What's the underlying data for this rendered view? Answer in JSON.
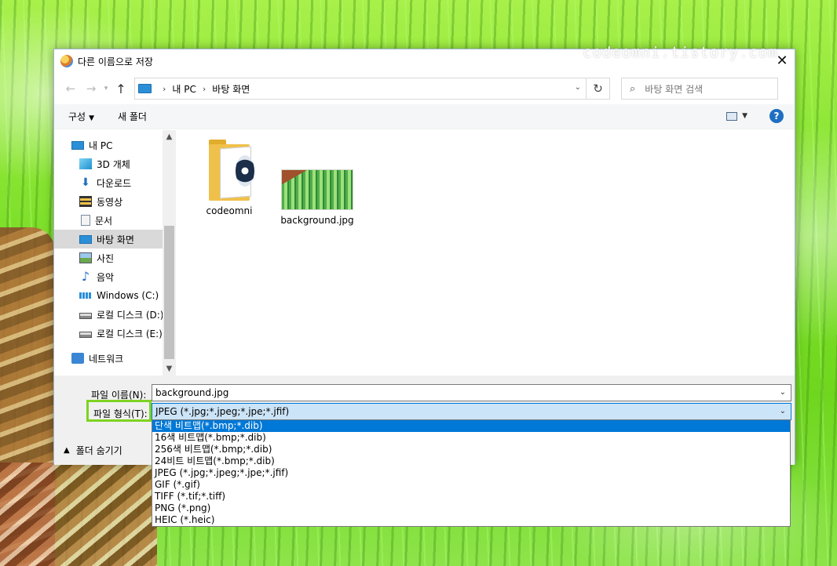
{
  "watermark": "codeomni.tistory.com",
  "dialog": {
    "title": "다른 이름으로 저장",
    "close_glyph": "✕"
  },
  "address": {
    "back_glyph": "←",
    "forward_glyph": "→",
    "up_glyph": "↑",
    "crumbs": [
      "내 PC",
      "바탕 화면"
    ],
    "refresh_glyph": "↻",
    "search_placeholder": "바탕 화면 검색"
  },
  "toolbar": {
    "organize_label": "구성",
    "new_folder_label": "새 폴더",
    "help_label": "?"
  },
  "nav": {
    "items": [
      {
        "label": "내 PC",
        "icon": "pc-icon"
      },
      {
        "label": "3D 개체",
        "icon": "3d-objects-icon"
      },
      {
        "label": "다운로드",
        "icon": "download-icon"
      },
      {
        "label": "동영상",
        "icon": "video-icon"
      },
      {
        "label": "문서",
        "icon": "document-icon"
      },
      {
        "label": "바탕 화면",
        "icon": "desktop-icon"
      },
      {
        "label": "사진",
        "icon": "picture-icon"
      },
      {
        "label": "음악",
        "icon": "music-icon"
      },
      {
        "label": "Windows (C:)",
        "icon": "windows-drive-icon"
      },
      {
        "label": "로컬 디스크 (D:)",
        "icon": "drive-icon"
      },
      {
        "label": "로컬 디스크 (E:)",
        "icon": "drive-icon"
      },
      {
        "label": "네트워크",
        "icon": "network-icon"
      }
    ]
  },
  "files": [
    {
      "name": "codeomni",
      "type": "folder"
    },
    {
      "name": "background.jpg",
      "type": "image"
    }
  ],
  "form": {
    "filename_label": "파일 이름(N):",
    "filename_value": "background.jpg",
    "filetype_label": "파일 형식(T):",
    "filetype_value": "JPEG (*.jpg;*.jpeg;*.jpe;*.jfif)",
    "hide_folders_label": "폴더 숨기기"
  },
  "filetype_options": [
    "단색 비트맵(*.bmp;*.dib)",
    "16색 비트맵(*.bmp;*.dib)",
    "256색 비트맵(*.bmp;*.dib)",
    "24비트 비트맵(*.bmp;*.dib)",
    "JPEG (*.jpg;*.jpeg;*.jpe;*.jfif)",
    "GIF (*.gif)",
    "TIFF (*.tif;*.tiff)",
    "PNG (*.png)",
    "HEIC (*.heic)"
  ],
  "colors": {
    "accent": "#0078d7",
    "highlight_box": "#7ed321"
  }
}
